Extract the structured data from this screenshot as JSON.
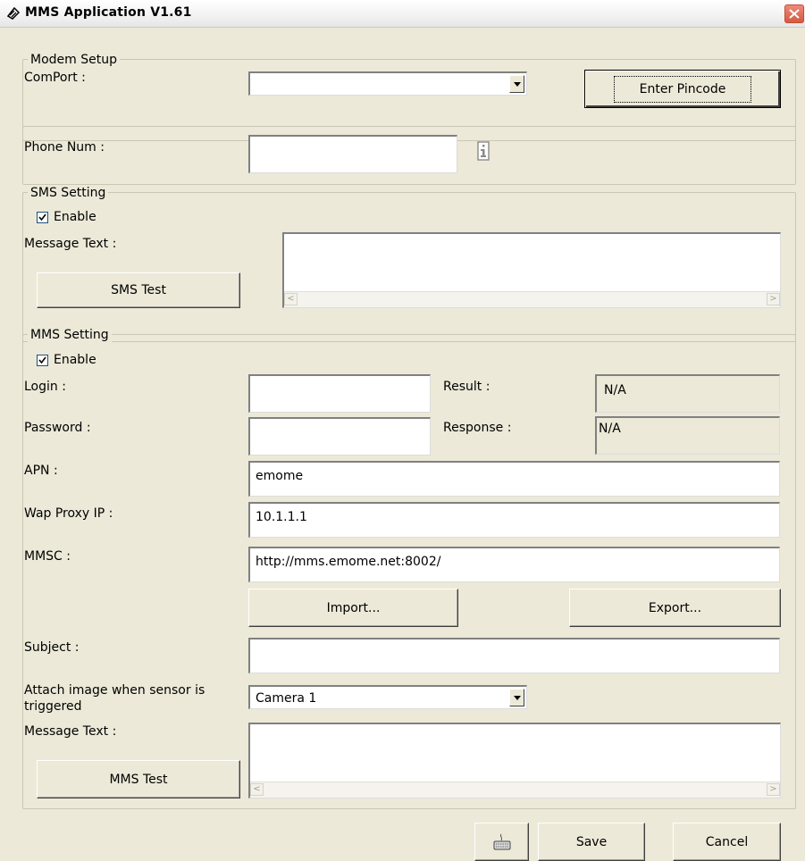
{
  "window": {
    "title": "MMS Application V1.61"
  },
  "modem_setup": {
    "legend": "Modem Setup",
    "comport_label": "ComPort :",
    "comport_value": "",
    "pincode_button": "Enter Pincode"
  },
  "phone": {
    "label": "Phone Num :",
    "value": ""
  },
  "sms": {
    "legend": "SMS Setting",
    "enable_label": "Enable",
    "enabled": true,
    "message_label": "Message Text :",
    "message_value": "",
    "test_button": "SMS Test"
  },
  "mms": {
    "legend": "MMS Setting",
    "enable_label": "Enable",
    "enabled": true,
    "login_label": "Login :",
    "login_value": "",
    "result_label": "Result :",
    "result_value": "N/A",
    "password_label": "Password :",
    "password_value": "",
    "response_label": "Response :",
    "response_value": "N/A",
    "apn_label": "APN :",
    "apn_value": "emome",
    "proxy_label": "Wap Proxy IP :",
    "proxy_value": "10.1.1.1",
    "mmsc_label": "MMSC :",
    "mmsc_value": "http://mms.emome.net:8002/",
    "import_button": "Import...",
    "export_button": "Export...",
    "subject_label": "Subject :",
    "subject_value": "",
    "attach_label": "Attach image when sensor is triggered",
    "attach_value": "Camera 1",
    "message_label": "Message Text :",
    "message_value": "",
    "test_button": "MMS Test"
  },
  "footer": {
    "save_button": "Save",
    "cancel_button": "Cancel"
  },
  "icons": {
    "title": "app-icon",
    "close": "close-icon",
    "info": "info-icon",
    "keyboard": "keyboard-icon"
  },
  "colors": {
    "background": "#ece9d8",
    "close": "#d35a42"
  }
}
